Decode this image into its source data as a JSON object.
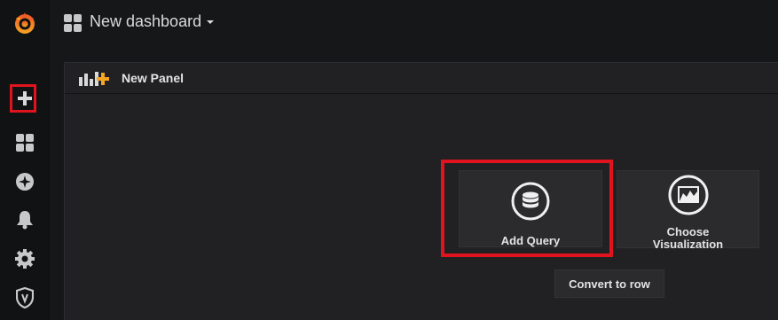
{
  "sidebar": {
    "items": [
      {
        "name": "grafana-logo-icon"
      },
      {
        "name": "plus-icon"
      },
      {
        "name": "dashboards-icon"
      },
      {
        "name": "explore-compass-icon"
      },
      {
        "name": "alerting-bell-icon"
      },
      {
        "name": "configuration-gear-icon"
      },
      {
        "name": "server-admin-shield-icon"
      }
    ]
  },
  "header": {
    "title": "New dashboard"
  },
  "panel": {
    "title": "New Panel",
    "actions": {
      "add_query": "Add Query",
      "choose_visualization_line1": "Choose",
      "choose_visualization_line2": "Visualization"
    },
    "convert_to_row": "Convert to row"
  },
  "colors": {
    "background": "#161719",
    "sidebar": "#111214",
    "panel": "#212124",
    "card": "#2b2b2e",
    "highlight": "#e0141e",
    "accent_orange": "#f5a623"
  }
}
